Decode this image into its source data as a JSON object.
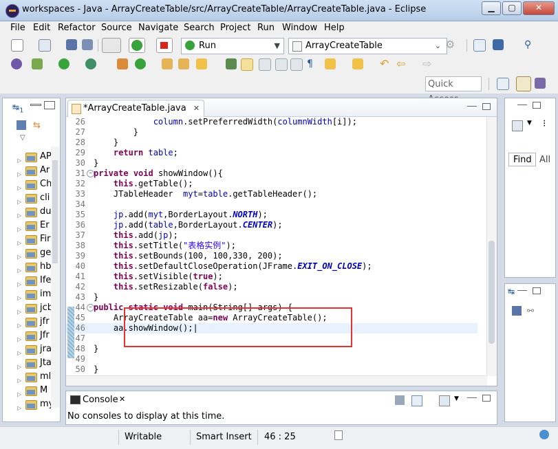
{
  "window": {
    "title": "workspaces - Java - ArrayCreateTable/src/ArrayCreateTable/ArrayCreateTable.java - Eclipse",
    "minimize": "▁",
    "maximize": "▢",
    "close": "✕"
  },
  "menu": [
    "File",
    "Edit",
    "Refactor",
    "Source",
    "Navigate",
    "Search",
    "Project",
    "Run",
    "Window",
    "Help"
  ],
  "toolbar": {
    "run_config": "Run",
    "launch_target": "ArrayCreateTable",
    "quick_access": "Quick Access"
  },
  "left_view": {
    "tab_label": "1",
    "packages": [
      "AP",
      "Ar",
      "Ch",
      "cli",
      "du",
      "Er",
      "Fir",
      "ge",
      "hb",
      "Ife",
      "im",
      "jcb",
      "jfr",
      "Jfr",
      "jra",
      "Jta",
      "ml",
      "M",
      "my"
    ]
  },
  "editor": {
    "tab_label": "*ArrayCreateTable.java",
    "lines": [
      {
        "n": "26",
        "html": "            <span class='fld'>column</span>.setPreferredWidth(<span class='fld'>columnWidth</span>[i]);"
      },
      {
        "n": "27",
        "html": "        }"
      },
      {
        "n": "28",
        "html": "    }"
      },
      {
        "n": "29",
        "html": "    <span class='kw'>return</span> <span class='fld'>table</span>;"
      },
      {
        "n": "30",
        "html": "}"
      },
      {
        "n": "31",
        "fold": true,
        "html": "<span class='kw'>private</span> <span class='kw'>void</span> showWindow(){"
      },
      {
        "n": "32",
        "html": "    <span class='kw'>this</span>.getTable();"
      },
      {
        "n": "33",
        "html": "    JTableHeader  <span class='fld'>myt</span>=<span class='fld'>table</span>.getTableHeader();"
      },
      {
        "n": "34",
        "html": ""
      },
      {
        "n": "35",
        "html": "    <span class='fld'>jp</span>.add(<span class='fld'>myt</span>,BorderLayout.<span class='cnst'>NORTH</span>);"
      },
      {
        "n": "36",
        "html": "    <span class='fld'>jp</span>.add(<span class='fld'>table</span>,BorderLayout.<span class='cnst'>CENTER</span>);"
      },
      {
        "n": "37",
        "html": "    <span class='kw'>this</span>.add(<span class='fld'>jp</span>);"
      },
      {
        "n": "38",
        "html": "    <span class='kw'>this</span>.setTitle(<span class='str'>\"表格实例\"</span>);"
      },
      {
        "n": "39",
        "html": "    <span class='kw'>this</span>.setBounds(100, 100,330, 200);"
      },
      {
        "n": "40",
        "html": "    <span class='kw'>this</span>.setDefaultCloseOperation(JFrame.<span class='cnst'>EXIT_ON_CLOSE</span>);"
      },
      {
        "n": "41",
        "html": "    <span class='kw'>this</span>.setVisible(<span class='kw'>true</span>);"
      },
      {
        "n": "42",
        "html": "    <span class='kw'>this</span>.setResizable(<span class='kw'>false</span>);"
      },
      {
        "n": "43",
        "html": "}"
      },
      {
        "n": "44",
        "fold": true,
        "html": "<span class='kw'>public</span> <span class='kw'>static</span> <span class='kw'>void</span> main(String[] args) {"
      },
      {
        "n": "45",
        "html": "    ArrayCreateTable aa=<span class='kw'>new</span> ArrayCreateTable();"
      },
      {
        "n": "46",
        "current": true,
        "html": "    aa.showWindow();|"
      },
      {
        "n": "47",
        "html": ""
      },
      {
        "n": "48",
        "html": "}"
      },
      {
        "n": "49",
        "html": ""
      },
      {
        "n": "50",
        "html": "}"
      }
    ]
  },
  "right_view": {
    "find_label": "Find",
    "all_label": "All"
  },
  "console": {
    "tab_label": "Console",
    "message": "No consoles to display at this time."
  },
  "status": {
    "mode": "Writable",
    "insert_mode": "Smart Insert",
    "position": "46 : 25"
  },
  "colors": {
    "keyword": "#7f0055",
    "field": "#0000c0",
    "string": "#2a00ff",
    "highlight_box": "#e8312f",
    "current_line": "#e8f2fe"
  }
}
